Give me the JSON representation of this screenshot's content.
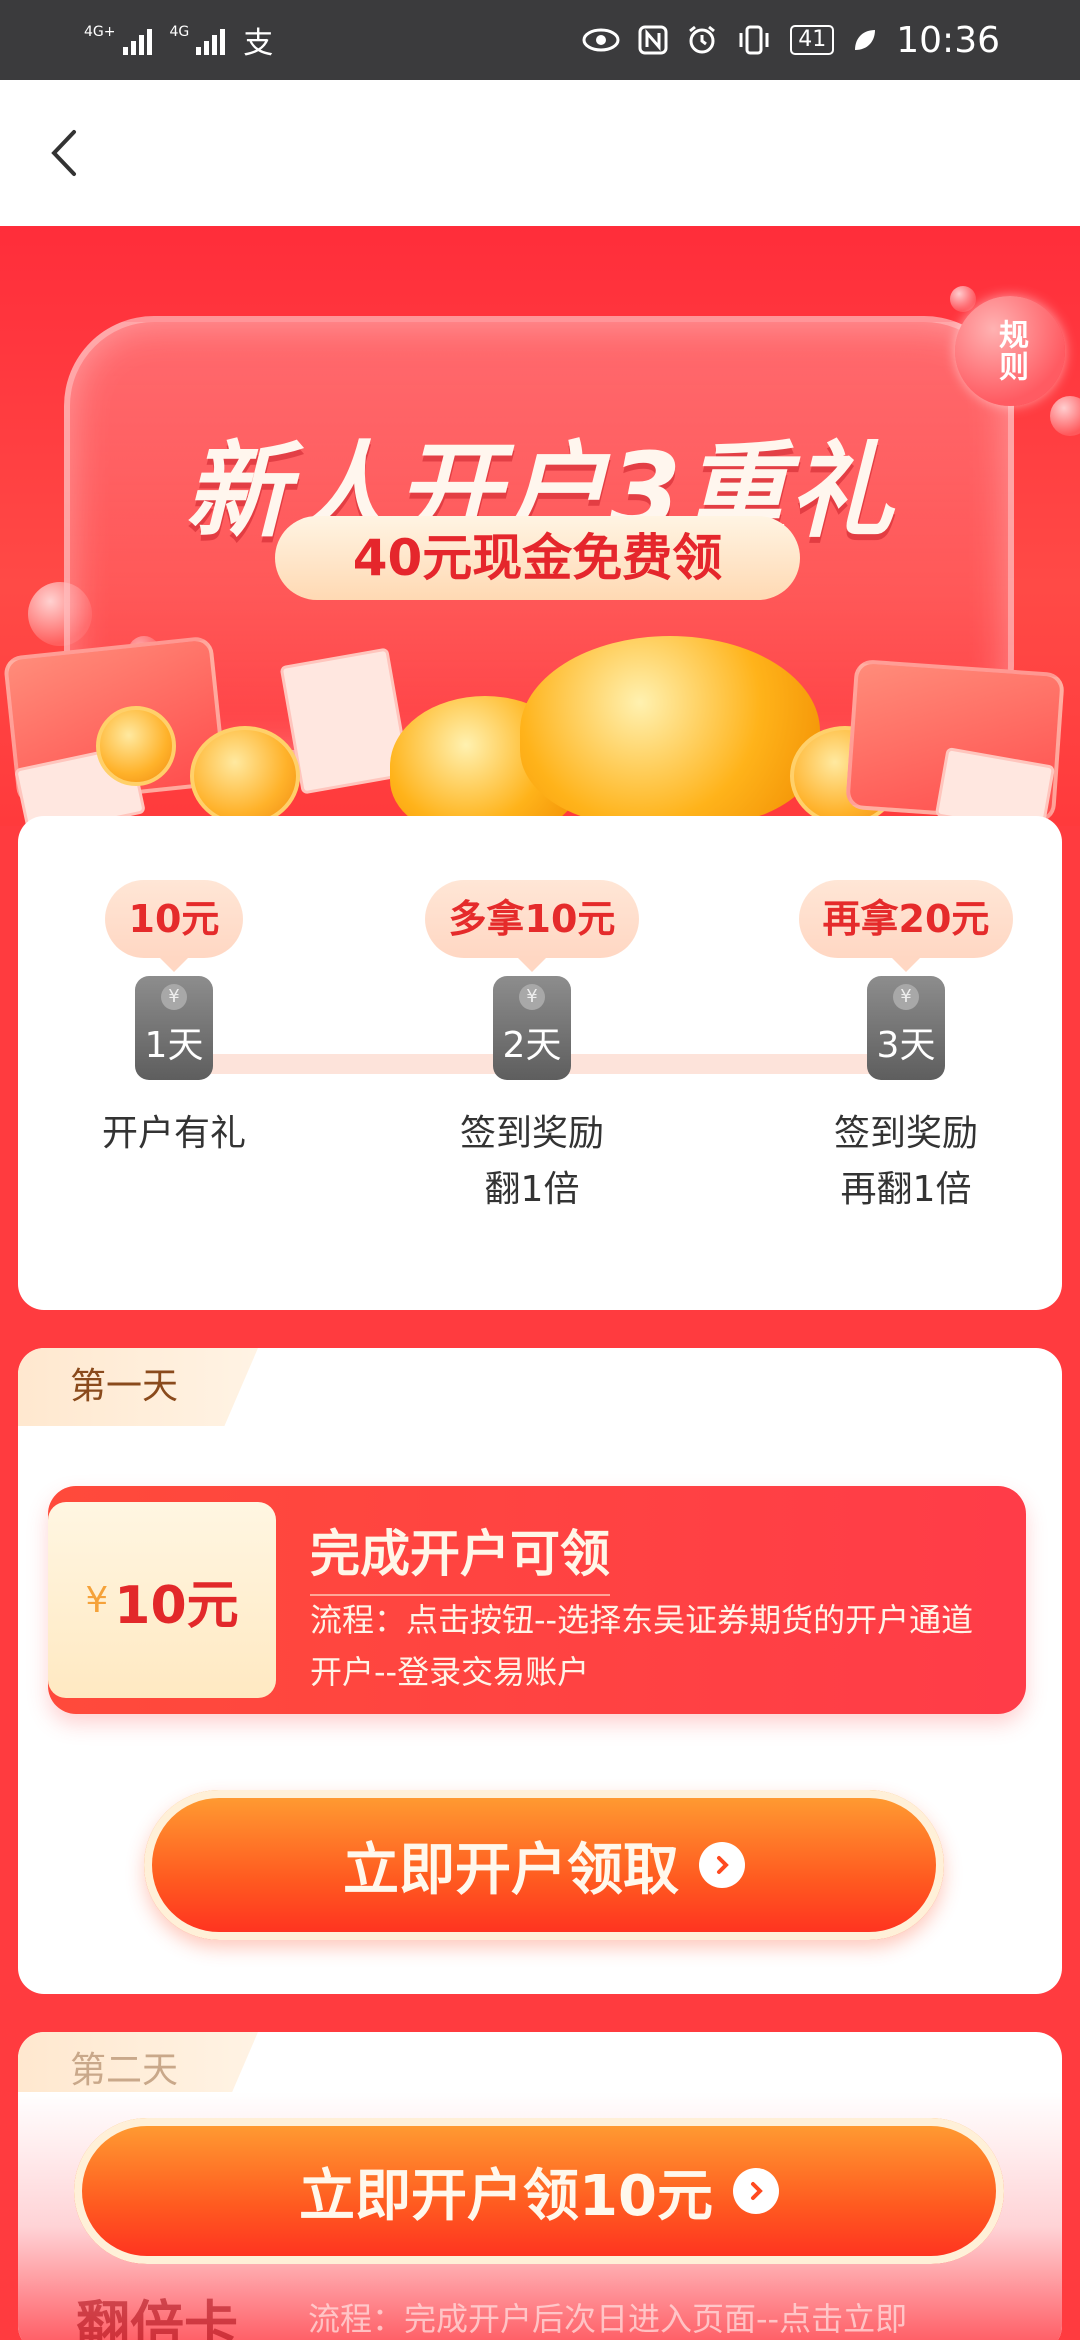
{
  "status_bar": {
    "signal1_label": "4G+",
    "signal2_label": "4G",
    "app_icon_label": "支",
    "battery": "41",
    "time": "10:36",
    "icons": [
      "eye-icon",
      "nfc-icon",
      "alarm-icon",
      "vibrate-icon",
      "battery-icon",
      "leaf-icon"
    ]
  },
  "header": {
    "back_icon": "chevron-left-icon"
  },
  "hero": {
    "title": "新人开户3重礼",
    "subtitle": "40元现金免费领",
    "rules_label": "规则"
  },
  "steps": [
    {
      "reward": "10元",
      "day": "1天",
      "label_line1": "开户有礼",
      "label_line2": ""
    },
    {
      "reward": "多拿10元",
      "day": "2天",
      "label_line1": "签到奖励",
      "label_line2": "翻1倍"
    },
    {
      "reward": "再拿20元",
      "day": "3天",
      "label_line1": "签到奖励",
      "label_line2": "再翻1倍"
    }
  ],
  "day1": {
    "tag": "第一天",
    "currency": "¥",
    "amount": "10元",
    "title": "完成开户可领",
    "description": "流程：点击按钮--选择东吴证券期货的开户通道开户--登录交易账户",
    "cta": "立即开户领取"
  },
  "day2": {
    "tag": "第二天",
    "cta": "立即开户领10元",
    "peek_title": "翻倍卡",
    "peek_desc": "流程：完成开户后次日进入页面--点击立即"
  },
  "colors": {
    "accent": "#ff3b3f",
    "gold": "#ffb31a",
    "cta_orange": "#ff5a20"
  }
}
